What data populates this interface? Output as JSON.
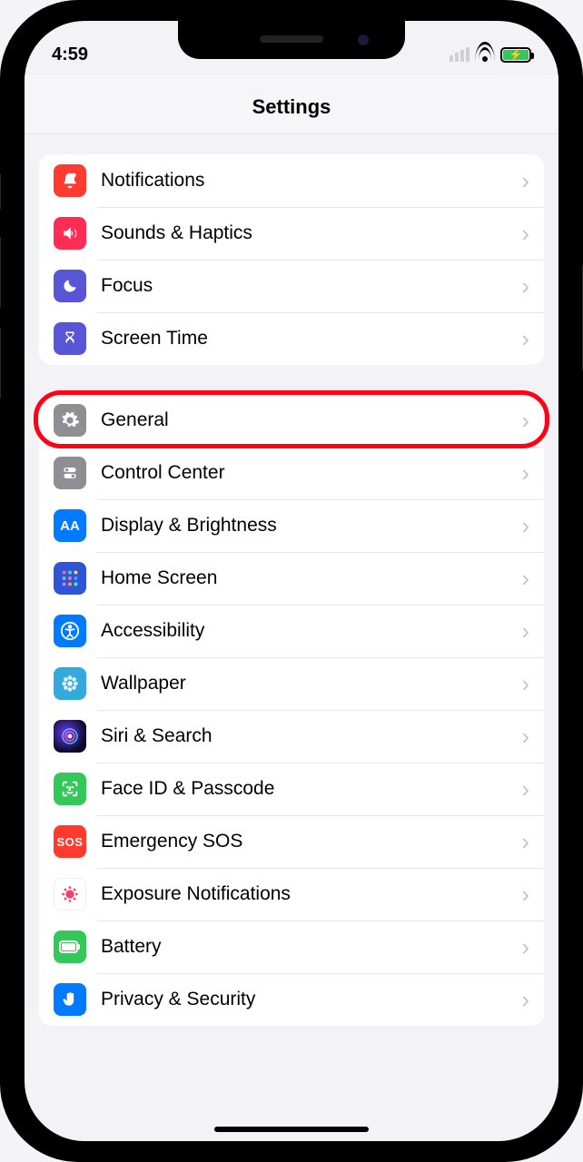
{
  "status": {
    "time": "4:59"
  },
  "header": {
    "title": "Settings"
  },
  "groups": [
    {
      "rows": [
        {
          "id": "notifications",
          "label": "Notifications",
          "iconClass": "ic-red",
          "iconName": "bell-icon"
        },
        {
          "id": "sounds",
          "label": "Sounds & Haptics",
          "iconClass": "ic-pink",
          "iconName": "speaker-icon"
        },
        {
          "id": "focus",
          "label": "Focus",
          "iconClass": "ic-indigo",
          "iconName": "moon-icon"
        },
        {
          "id": "screentime",
          "label": "Screen Time",
          "iconClass": "ic-indigo2",
          "iconName": "hourglass-icon"
        }
      ]
    },
    {
      "rows": [
        {
          "id": "general",
          "label": "General",
          "iconClass": "ic-gray",
          "iconName": "gear-icon",
          "highlighted": true
        },
        {
          "id": "controlcenter",
          "label": "Control Center",
          "iconClass": "ic-gray2",
          "iconName": "switches-icon"
        },
        {
          "id": "display",
          "label": "Display & Brightness",
          "iconClass": "ic-blue",
          "iconName": "text-size-icon"
        },
        {
          "id": "homescreen",
          "label": "Home Screen",
          "iconClass": "ic-bluehome",
          "iconName": "grid-icon"
        },
        {
          "id": "accessibility",
          "label": "Accessibility",
          "iconClass": "ic-access",
          "iconName": "accessibility-icon"
        },
        {
          "id": "wallpaper",
          "label": "Wallpaper",
          "iconClass": "ic-cyan",
          "iconName": "flower-icon"
        },
        {
          "id": "siri",
          "label": "Siri & Search",
          "iconClass": "ic-siri",
          "iconName": "siri-icon"
        },
        {
          "id": "faceid",
          "label": "Face ID & Passcode",
          "iconClass": "ic-green",
          "iconName": "faceid-icon"
        },
        {
          "id": "sos",
          "label": "Emergency SOS",
          "iconClass": "ic-sos",
          "iconName": "sos-icon",
          "textIcon": "SOS"
        },
        {
          "id": "exposure",
          "label": "Exposure Notifications",
          "iconClass": "ic-white",
          "iconName": "virus-icon"
        },
        {
          "id": "battery",
          "label": "Battery",
          "iconClass": "ic-batt",
          "iconName": "battery-icon"
        },
        {
          "id": "privacy",
          "label": "Privacy & Security",
          "iconClass": "ic-hand",
          "iconName": "hand-icon"
        }
      ]
    }
  ]
}
